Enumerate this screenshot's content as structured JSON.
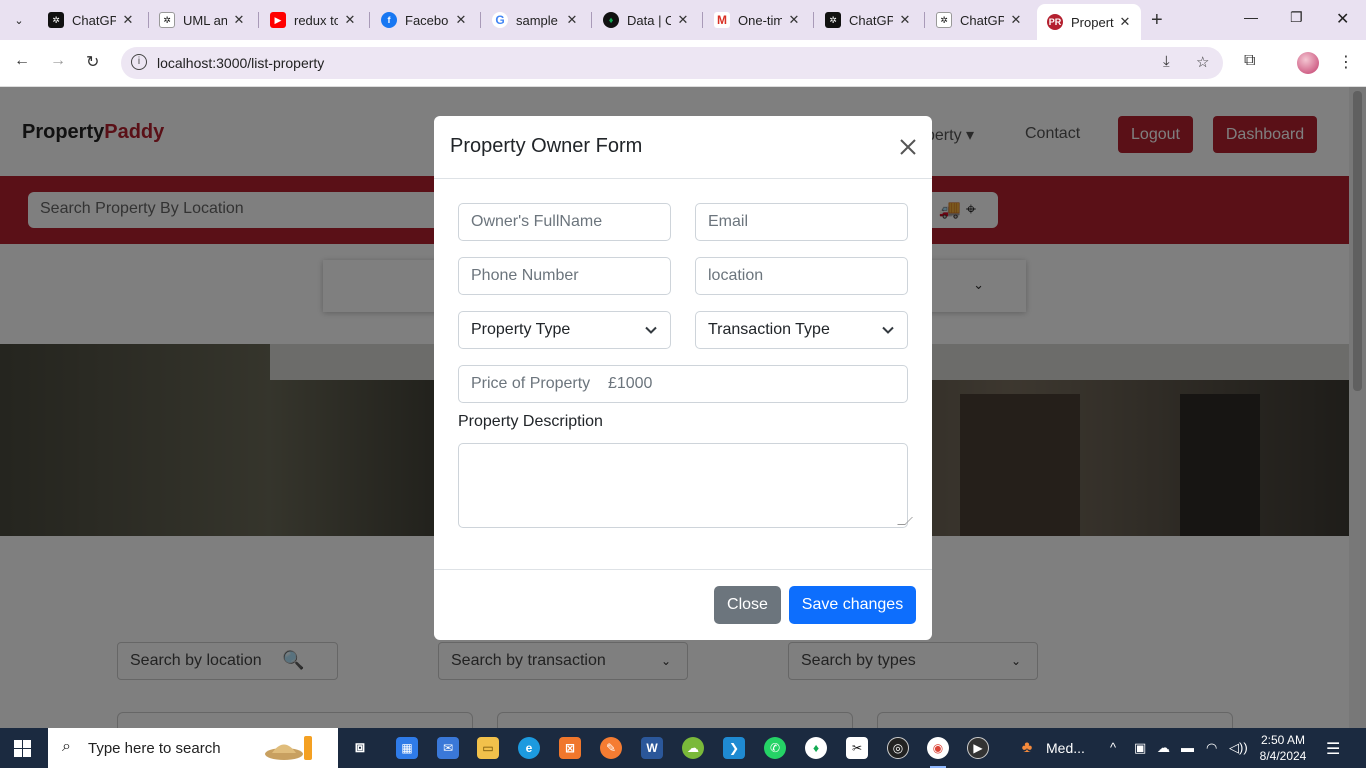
{
  "browser": {
    "tabs": [
      {
        "title": "ChatGPT",
        "favicon": "chatgpt-icon"
      },
      {
        "title": "UML and",
        "favicon": "chatgpt-icon"
      },
      {
        "title": "redux to",
        "favicon": "youtube-icon"
      },
      {
        "title": "Facebook",
        "favicon": "facebook-icon"
      },
      {
        "title": "sample",
        "favicon": "google-icon"
      },
      {
        "title": "Data | C",
        "favicon": "mongodb-icon"
      },
      {
        "title": "One-tim",
        "favicon": "gmail-icon"
      },
      {
        "title": "ChatGPT",
        "favicon": "chatgpt-icon"
      },
      {
        "title": "ChatGPT",
        "favicon": "chatgpt-icon"
      },
      {
        "title": "Propert",
        "favicon": "propertypaddy-icon"
      }
    ],
    "active_favicon_text": "PR",
    "url": "localhost:3000/list-property"
  },
  "site": {
    "brand_part1": "Property",
    "brand_part2": "Paddy",
    "nav_dropdown_fragment": "perty",
    "nav_contact": "Contact",
    "logout": "Logout",
    "dashboard": "Dashboard",
    "search_placeholder": "Search Property By Location",
    "lower_search_location": "Search by location",
    "lower_search_transaction": "Search by transaction",
    "lower_search_types": "Search by types"
  },
  "modal": {
    "title": "Property Owner Form",
    "owner_placeholder": "Owner's FullName",
    "email_placeholder": "Email",
    "phone_placeholder": "Phone Number",
    "location_placeholder": "location",
    "property_type": "Property Type",
    "transaction_type": "Transaction Type",
    "price_placeholder": "Price of Property    £1000",
    "description_label": "Property Description",
    "close_label": "Close",
    "save_label": "Save changes"
  },
  "taskbar": {
    "search_placeholder": "Type here to search",
    "media_label": "Med...",
    "time": "2:50 AM",
    "date": "8/4/2024"
  },
  "colors": {
    "brand_red": "#b4202f",
    "primary_blue": "#0d6efd",
    "secondary_gray": "#6c757d"
  }
}
